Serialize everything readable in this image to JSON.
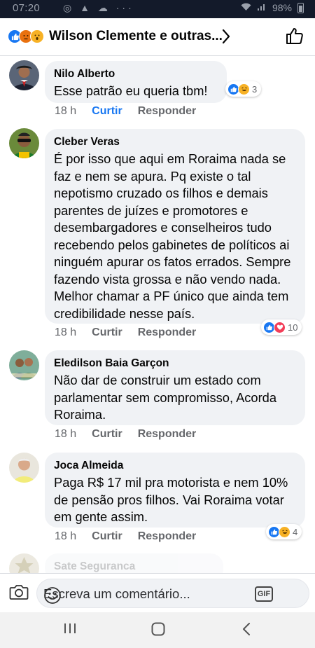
{
  "status_bar": {
    "time": "07:20",
    "left_icons": "◎ ▲ ☁ ···",
    "battery": "98%"
  },
  "header": {
    "title": "Wilson Clemente e outras...",
    "reactions": [
      "like-icon",
      "angry-icon",
      "wow-icon"
    ]
  },
  "comments": [
    {
      "author": "Nilo Alberto",
      "text": "Esse patrão eu queria tbm!",
      "time": "18 h",
      "like_label": "Curtir",
      "reply_label": "Responder",
      "reaction_count": "3",
      "liked": true
    },
    {
      "author": "Cleber Veras",
      "text": "É por isso que aqui em Roraima nada se faz e nem se apura. Pq existe o tal nepotismo cruzado os filhos e demais parentes de juízes e promotores e desembargadores e conselheiros tudo recebendo pelos gabinetes de políticos ai ninguém apurar os fatos errados. Sempre fazendo vista grossa e não vendo nada. Melhor chamar a PF único que ainda tem credibilidade nesse país.",
      "time": "18 h",
      "like_label": "Curtir",
      "reply_label": "Responder",
      "reaction_count": "10",
      "liked": false
    },
    {
      "author": "Eledilson Baia Garçon",
      "text": "Não dar de construir um estado com parlamentar sem compromisso, Acorda Roraima.",
      "time": "18 h",
      "like_label": "Curtir",
      "reply_label": "Responder",
      "liked": false
    },
    {
      "author": "Joca Almeida",
      "text": "Paga R$ 17 mil pra motorista e nem 10% de pensão pros filhos. Vai Roraima votar em gente assim.",
      "time": "18 h",
      "like_label": "Curtir",
      "reply_label": "Responder",
      "reaction_count": "4",
      "liked": false
    },
    {
      "author": "Sate Seguranca"
    }
  ],
  "composer": {
    "placeholder": "Escreva um comentário...",
    "gif_label": "GIF"
  },
  "colors": {
    "accent": "#1877f2",
    "love": "#f33e58",
    "haha": "#f7b125",
    "angry": "#e9710f"
  }
}
